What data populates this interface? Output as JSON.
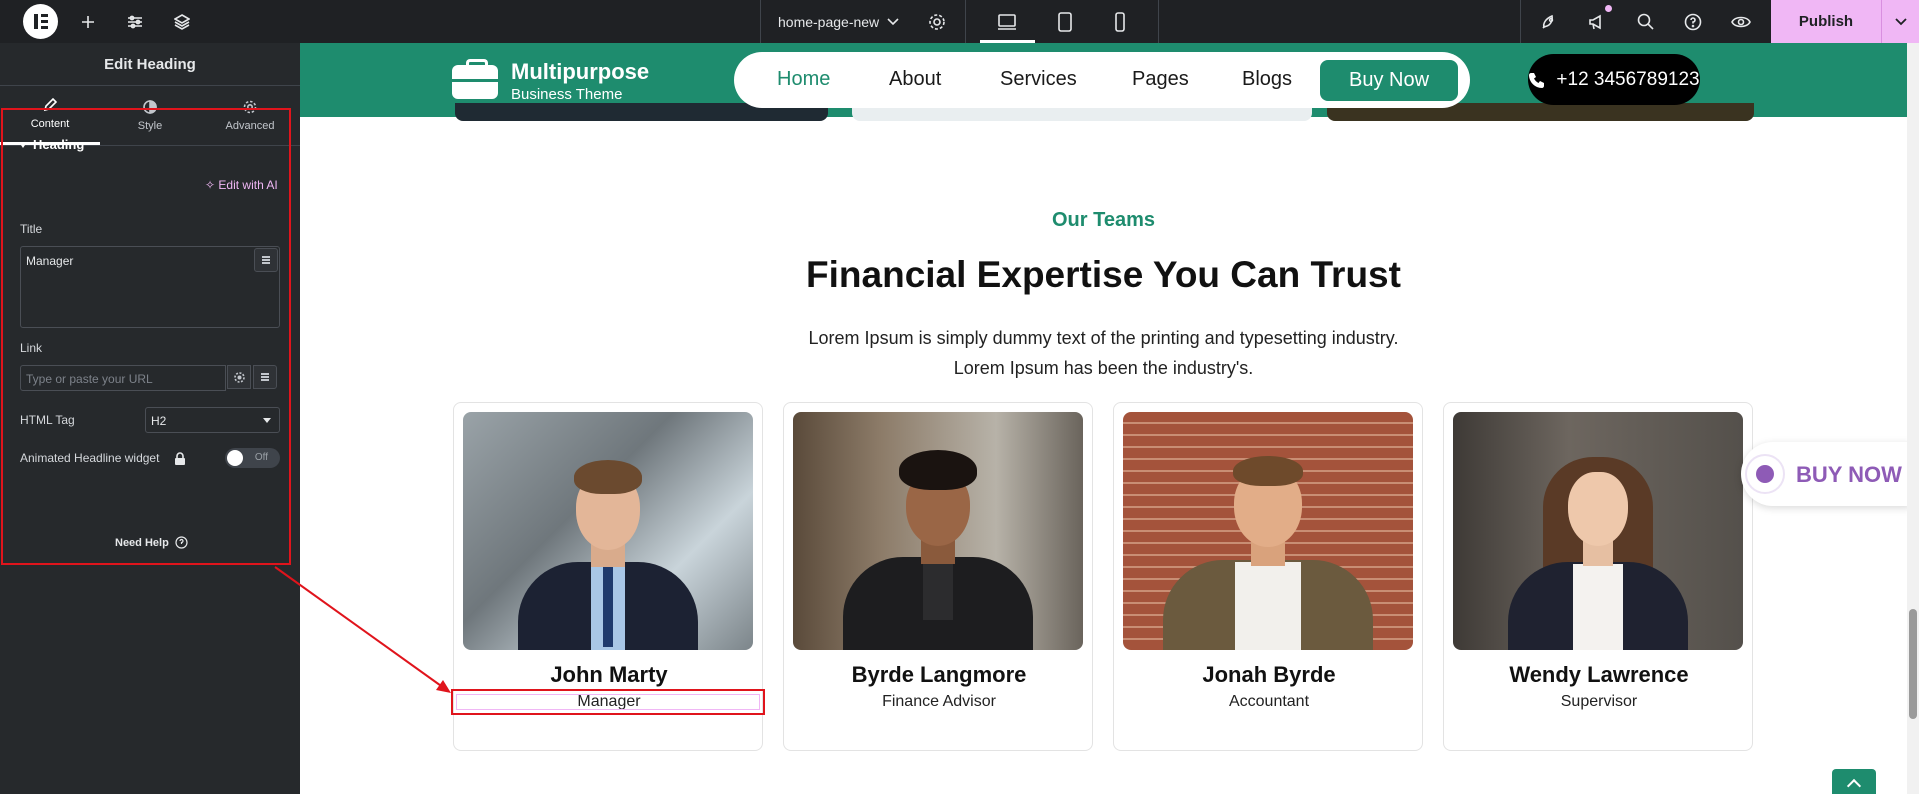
{
  "topbar": {
    "document_name": "home-page-new",
    "publish_label": "Publish"
  },
  "panel": {
    "title": "Edit Heading",
    "tabs": [
      {
        "label": "Content",
        "icon": "pencil-icon"
      },
      {
        "label": "Style",
        "icon": "half-circle-icon"
      },
      {
        "label": "Advanced",
        "icon": "gear-icon"
      }
    ],
    "section_title": "Heading",
    "title_label": "Title",
    "ai_link": "Edit with AI",
    "title_value": "Manager",
    "link_label": "Link",
    "link_placeholder": "Type or paste your URL",
    "html_tag_label": "HTML Tag",
    "html_tag_value": "H2",
    "animated_label": "Animated Headline widget",
    "toggle_text": "Off",
    "need_help": "Need Help"
  },
  "site": {
    "brand_name": "Multipurpose",
    "brand_sub": "Business Theme",
    "nav": [
      {
        "label": "Home",
        "active": true
      },
      {
        "label": "About",
        "active": false
      },
      {
        "label": "Services",
        "active": false
      },
      {
        "label": "Pages",
        "active": false
      },
      {
        "label": "Blogs",
        "active": false
      }
    ],
    "buy_button": "Buy Now",
    "phone": "+12 3456789123",
    "eyebrow": "Our Teams",
    "headline": "Financial Expertise You Can Trust",
    "description_line1": "Lorem Ipsum is simply dummy text of the printing and typesetting industry.",
    "description_line2": "Lorem Ipsum has been the industry's.",
    "team": [
      {
        "name": "John Marty",
        "role": "Manager"
      },
      {
        "name": "Byrde Langmore",
        "role": "Finance Advisor"
      },
      {
        "name": "Jonah Byrde",
        "role": "Accountant"
      },
      {
        "name": "Wendy Lawrence",
        "role": "Supervisor"
      }
    ],
    "float_buy": "BUY NOW"
  },
  "colors": {
    "brand_green": "#1e8c6e",
    "editor_dark": "#26292c",
    "publish_pink": "#f0b7f5",
    "annotation_red": "#e0141c"
  }
}
